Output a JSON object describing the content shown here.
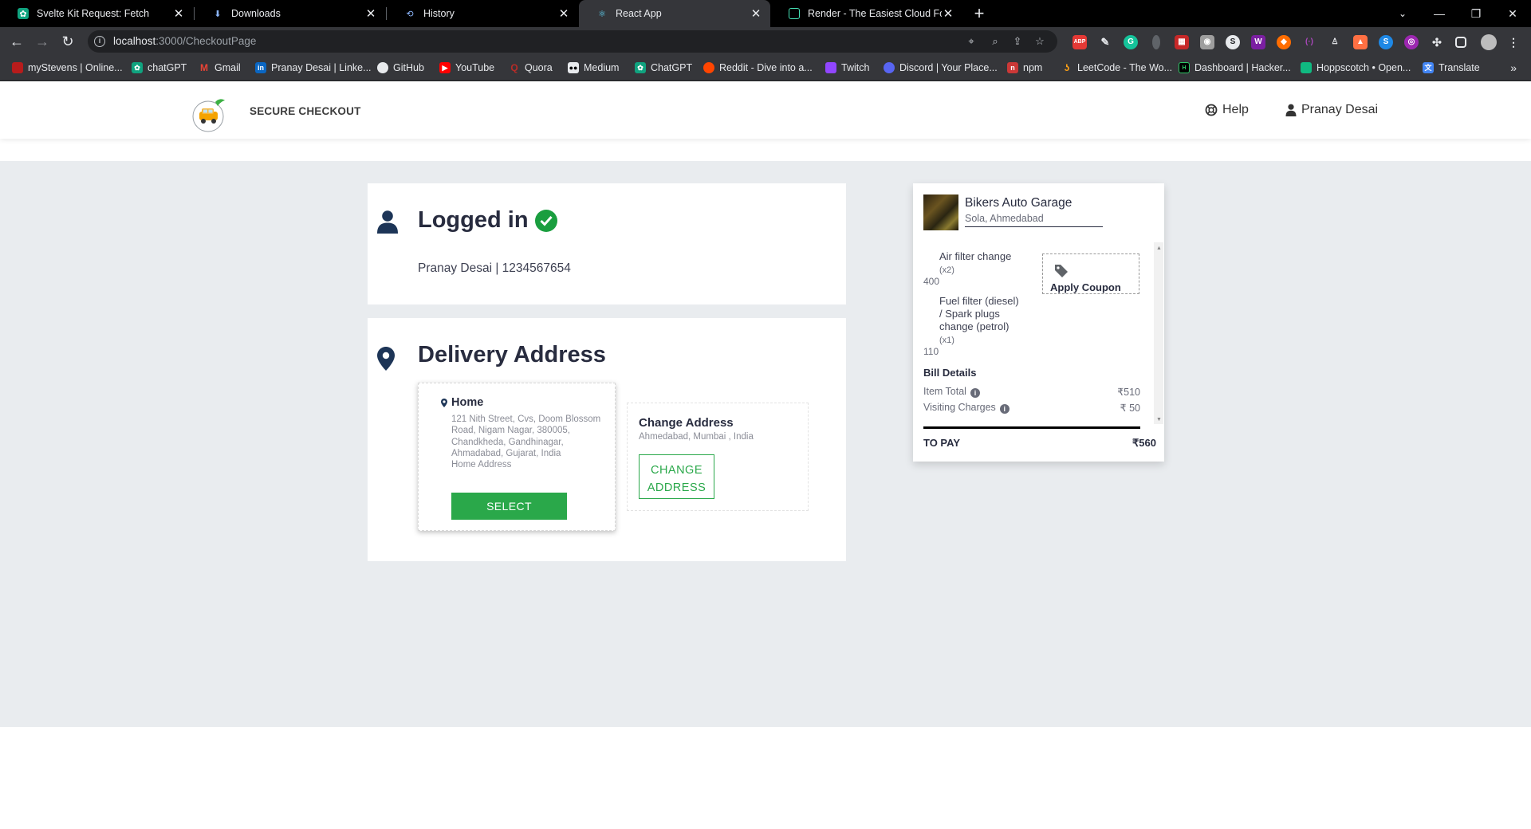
{
  "browser": {
    "tabs": [
      {
        "title": "Svelte Kit Request: Fetch",
        "active": false
      },
      {
        "title": "Downloads",
        "active": false
      },
      {
        "title": "History",
        "active": false
      },
      {
        "title": "React App",
        "active": true
      },
      {
        "title": "Render - The Easiest Cloud For All",
        "active": false
      }
    ],
    "url_host": "localhost",
    "url_rest": ":3000/CheckoutPage",
    "bookmarks": [
      "myStevens | Online...",
      "chatGPT",
      "Gmail",
      "Pranay Desai | Linke...",
      "GitHub",
      "YouTube",
      "Quora",
      "Medium",
      "ChatGPT",
      "Reddit - Dive into a...",
      "Twitch",
      "Discord | Your Place...",
      "npm",
      "LeetCode - The Wo...",
      "Dashboard | Hacker...",
      "Hoppscotch • Open...",
      "Translate"
    ],
    "more_bookmarks": "»"
  },
  "header": {
    "secure_checkout": "SECURE CHECKOUT",
    "help": "Help",
    "user_name": "Pranay Desai"
  },
  "login": {
    "title": "Logged in",
    "user_line": "Pranay Desai | 1234567654"
  },
  "delivery": {
    "title": "Delivery Address",
    "home": {
      "label": "Home",
      "address": "121 Nith Street, Cvs, Doom Blossom Road, Nigam Nagar, 380005, Chandkheda, Gandhinagar, Ahmadabad, Gujarat, India",
      "type": "Home Address",
      "select_label": "SELECT"
    },
    "change": {
      "title": "Change Address",
      "subtitle": "Ahmedabad, Mumbai , India",
      "button_line1": "CHANGE",
      "button_line2": "ADDRESS"
    }
  },
  "cart": {
    "garage_name": "Bikers Auto Garage",
    "garage_location": "Sola, Ahmedabad",
    "items": [
      {
        "name": "Air filter change",
        "qty": "(x2)",
        "price": "400"
      },
      {
        "name": "Fuel filter (diesel) / Spark plugs change (petrol)",
        "qty": "(x1)",
        "price": "110"
      }
    ],
    "coupon_label": "Apply Coupon",
    "bill_details_label": "Bill Details",
    "item_total_label": "Item Total",
    "item_total_value": "₹510",
    "visiting_label": "Visiting Charges",
    "visiting_value": "₹ 50",
    "to_pay_label": "TO PAY",
    "to_pay_value": "₹560"
  },
  "colors": {
    "accent_green": "#2aa84a",
    "icon_navy": "#1d3557",
    "page_bg": "#e9ecef"
  }
}
